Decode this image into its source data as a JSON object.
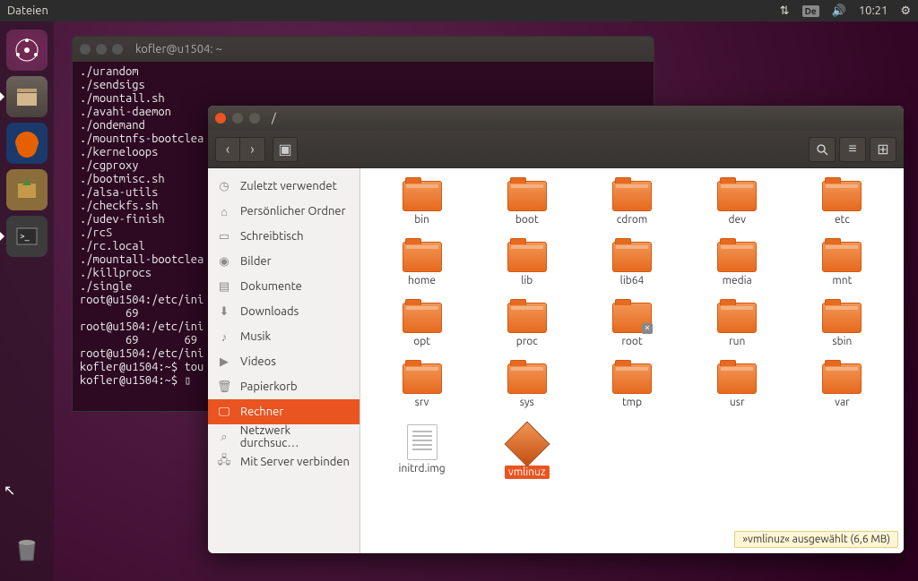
{
  "panel": {
    "app_menu": "Dateien",
    "kbd": "De",
    "time": "10:21"
  },
  "launcher": {
    "items": [
      "dash",
      "files",
      "firefox",
      "software",
      "terminal"
    ],
    "trash": "trash"
  },
  "terminal": {
    "title": "kofler@u1504: ~",
    "lines": [
      "./urandom",
      "./sendsigs",
      "./mountall.sh",
      "./avahi-daemon",
      "./ondemand",
      "./mountnfs-bootclea",
      "./kerneloops",
      "./cgproxy",
      "./bootmisc.sh",
      "./alsa-utils",
      "./checkfs.sh",
      "./udev-finish",
      "./rcS",
      "./rc.local",
      "./mountall-bootclea",
      "./killprocs",
      "./single",
      "root@u1504:/etc/ini",
      "       69",
      "root@u1504:/etc/ini",
      "       69       69",
      "root@u1504:/etc/ini",
      "kofler@u1504:~$ tou",
      "kofler@u1504:~$ ▯"
    ]
  },
  "nautilus": {
    "title": "/",
    "sidebar": [
      {
        "icon": "clock",
        "label": "Zuletzt verwendet"
      },
      {
        "icon": "home",
        "label": "Persönlicher Ordner"
      },
      {
        "icon": "desktop",
        "label": "Schreibtisch"
      },
      {
        "icon": "camera",
        "label": "Bilder"
      },
      {
        "icon": "doc",
        "label": "Dokumente"
      },
      {
        "icon": "down",
        "label": "Downloads"
      },
      {
        "icon": "music",
        "label": "Musik"
      },
      {
        "icon": "video",
        "label": "Videos"
      },
      {
        "icon": "trash",
        "label": "Papierkorb"
      },
      {
        "icon": "computer",
        "label": "Rechner",
        "selected": true
      },
      {
        "icon": "network",
        "label": "Netzwerk durchsuc…"
      },
      {
        "icon": "server",
        "label": "Mit Server verbinden"
      }
    ],
    "files": [
      {
        "name": "bin",
        "type": "folder"
      },
      {
        "name": "boot",
        "type": "folder"
      },
      {
        "name": "cdrom",
        "type": "folder"
      },
      {
        "name": "dev",
        "type": "folder"
      },
      {
        "name": "etc",
        "type": "folder"
      },
      {
        "name": "home",
        "type": "folder"
      },
      {
        "name": "lib",
        "type": "folder"
      },
      {
        "name": "lib64",
        "type": "folder"
      },
      {
        "name": "media",
        "type": "folder"
      },
      {
        "name": "mnt",
        "type": "folder"
      },
      {
        "name": "opt",
        "type": "folder"
      },
      {
        "name": "proc",
        "type": "folder"
      },
      {
        "name": "root",
        "type": "folder",
        "locked": true
      },
      {
        "name": "run",
        "type": "folder"
      },
      {
        "name": "sbin",
        "type": "folder"
      },
      {
        "name": "srv",
        "type": "folder"
      },
      {
        "name": "sys",
        "type": "folder"
      },
      {
        "name": "tmp",
        "type": "folder"
      },
      {
        "name": "usr",
        "type": "folder"
      },
      {
        "name": "var",
        "type": "folder"
      },
      {
        "name": "initrd.img",
        "type": "text"
      },
      {
        "name": "vmlinuz",
        "type": "diamond",
        "selected": true
      }
    ],
    "status": "»vmlinuz« ausgewählt  (6,6 MB)"
  }
}
